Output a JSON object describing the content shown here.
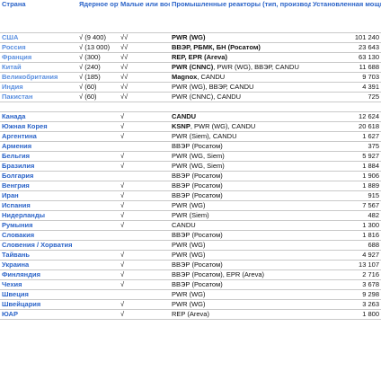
{
  "headers": {
    "country": "Страна",
    "nuclear_weapons": "Ядерное оружие",
    "small_military": "Малые или военные реакторы",
    "industrial": "Промышленные реакторы (тип, производитель)",
    "capacity": "Установленная мощность, МВт"
  },
  "group1": [
    {
      "country": "США",
      "weapons": "√ (9 400)",
      "small": "√√",
      "brand": "PWR (WG)",
      "rest": "",
      "capacity": "101 240"
    },
    {
      "country": "Россия",
      "weapons": "√ (13 000)",
      "small": "√√",
      "brand": "ВВЭР, РБМК, БН (Росатом)",
      "rest": "",
      "capacity": "23 643"
    },
    {
      "country": "Франция",
      "weapons": "√ (300)",
      "small": "√√",
      "brand": "REP, EPR (Areva)",
      "rest": "",
      "capacity": "63 130"
    },
    {
      "country": "Китай",
      "weapons": "√ (240)",
      "small": "√√",
      "brand": "PWR (CNNC)",
      "rest": ", PWR (WG), ВВЭР, CANDU",
      "capacity": "11 688"
    },
    {
      "country": "Великобритания",
      "weapons": "√ (185)",
      "small": "√√",
      "brand": "Magnox",
      "rest": ", CANDU",
      "capacity": "9 703"
    },
    {
      "country": "Индия",
      "weapons": "√ (60)",
      "small": "√√",
      "brand": "",
      "rest": "PWR (WG), ВВЭР, CANDU",
      "capacity": "4 391"
    },
    {
      "country": "Пакистан",
      "weapons": "√ (60)",
      "small": "√√",
      "brand": "",
      "rest": "PWR (CNNC), CANDU",
      "capacity": "725"
    }
  ],
  "group2": [
    {
      "country": "Канада",
      "weapons": "",
      "small": "√",
      "brand": "CANDU",
      "rest": "",
      "capacity": "12 624"
    },
    {
      "country": "Южная Корея",
      "weapons": "",
      "small": "√",
      "brand": "KSNP",
      "rest": ", PWR (WG), CANDU",
      "capacity": "20 618"
    },
    {
      "country": "Аргентина",
      "weapons": "",
      "small": "√",
      "brand": "",
      "rest": "PWR (Siem), CANDU",
      "capacity": "1 627"
    },
    {
      "country": "Армения",
      "weapons": "",
      "small": "",
      "brand": "",
      "rest": "ВВЭР (Росатом)",
      "capacity": "375"
    },
    {
      "country": "Бельгия",
      "weapons": "",
      "small": "√",
      "brand": "",
      "rest": "PWR (WG, Siem)",
      "capacity": "5 927"
    },
    {
      "country": "Бразилия",
      "weapons": "",
      "small": "√",
      "brand": "",
      "rest": "PWR (WG, Siem)",
      "capacity": "1 884"
    },
    {
      "country": "Болгария",
      "weapons": "",
      "small": "",
      "brand": "",
      "rest": "ВВЭР (Росатом)",
      "capacity": "1 906"
    },
    {
      "country": "Венгрия",
      "weapons": "",
      "small": "√",
      "brand": "",
      "rest": "ВВЭР (Росатом)",
      "capacity": "1 889"
    },
    {
      "country": "Иран",
      "weapons": "",
      "small": "√",
      "brand": "",
      "rest": "ВВЭР (Росатом)",
      "capacity": "915"
    },
    {
      "country": "Испания",
      "weapons": "",
      "small": "√",
      "brand": "",
      "rest": "PWR (WG)",
      "capacity": "7 567"
    },
    {
      "country": "Нидерланды",
      "weapons": "",
      "small": "√",
      "brand": "",
      "rest": "PWR (Siem)",
      "capacity": "482"
    },
    {
      "country": "Румыния",
      "weapons": "",
      "small": "√",
      "brand": "",
      "rest": "CANDU",
      "capacity": "1 300"
    },
    {
      "country": "Словакия",
      "weapons": "",
      "small": "",
      "brand": "",
      "rest": "ВВЭР (Росатом)",
      "capacity": "1 816"
    },
    {
      "country": "Словения / Хорватия",
      "weapons": "",
      "small": "",
      "brand": "",
      "rest": "PWR (WG)",
      "capacity": "688"
    },
    {
      "country": "Тайвань",
      "weapons": "",
      "small": "√",
      "brand": "",
      "rest": "PWR (WG)",
      "capacity": "4 927"
    },
    {
      "country": "Украина",
      "weapons": "",
      "small": "√",
      "brand": "",
      "rest": "ВВЭР (Росатом)",
      "capacity": "13 107"
    },
    {
      "country": "Финляндия",
      "weapons": "",
      "small": "√",
      "brand": "",
      "rest": "ВВЭР (Росатом), EPR (Areva)",
      "capacity": "2 716"
    },
    {
      "country": "Чехия",
      "weapons": "",
      "small": "√",
      "brand": "",
      "rest": "ВВЭР (Росатом)",
      "capacity": "3 678"
    },
    {
      "country": "Швеция",
      "weapons": "",
      "small": "",
      "brand": "",
      "rest": "PWR (WG)",
      "capacity": "9 298"
    },
    {
      "country": "Швейцария",
      "weapons": "",
      "small": "√",
      "brand": "",
      "rest": "PWR (WG)",
      "capacity": "3 263"
    },
    {
      "country": "ЮАР",
      "weapons": "",
      "small": "√",
      "brand": "",
      "rest": "REP (Areva)",
      "capacity": "1 800"
    }
  ]
}
